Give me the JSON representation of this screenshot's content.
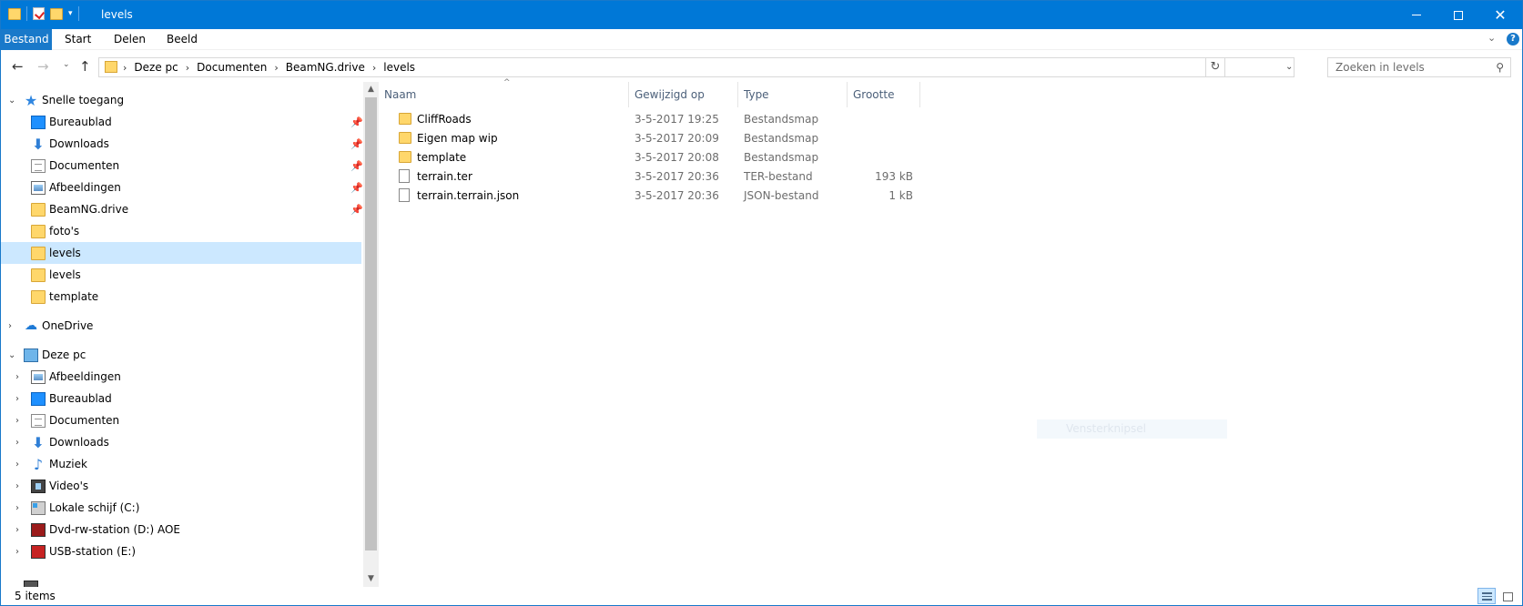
{
  "window": {
    "title": "levels",
    "controls": {
      "minimize": "minimize",
      "maximize": "maximize",
      "close": "close"
    }
  },
  "ribbon": {
    "tabs": [
      {
        "label": "Bestand",
        "active": true
      },
      {
        "label": "Start"
      },
      {
        "label": "Delen"
      },
      {
        "label": "Beeld"
      }
    ],
    "help_label": "?"
  },
  "navigation": {
    "breadcrumb": [
      "Deze pc",
      "Documenten",
      "BeamNG.drive",
      "levels"
    ],
    "search_placeholder": "Zoeken in levels"
  },
  "nav_pane": {
    "quick_access": {
      "label": "Snelle toegang",
      "icon": "star-icon",
      "items": [
        {
          "label": "Bureaublad",
          "icon": "desktop-icon",
          "pinned": true
        },
        {
          "label": "Downloads",
          "icon": "download-arrow-icon",
          "pinned": true
        },
        {
          "label": "Documenten",
          "icon": "document-icon",
          "pinned": true
        },
        {
          "label": "Afbeeldingen",
          "icon": "pictures-icon",
          "pinned": true
        },
        {
          "label": "BeamNG.drive",
          "icon": "folder-icon",
          "pinned": true
        },
        {
          "label": "foto's",
          "icon": "folder-icon"
        },
        {
          "label": "levels",
          "icon": "folder-icon",
          "selected": true
        },
        {
          "label": "levels",
          "icon": "folder-icon"
        },
        {
          "label": "template",
          "icon": "folder-icon"
        }
      ]
    },
    "onedrive": {
      "label": "OneDrive",
      "icon": "cloud-icon"
    },
    "this_pc": {
      "label": "Deze pc",
      "icon": "computer-icon",
      "items": [
        {
          "label": "Afbeeldingen",
          "icon": "pictures-icon"
        },
        {
          "label": "Bureaublad",
          "icon": "desktop-icon"
        },
        {
          "label": "Documenten",
          "icon": "document-icon"
        },
        {
          "label": "Downloads",
          "icon": "download-arrow-icon"
        },
        {
          "label": "Muziek",
          "icon": "music-note-icon"
        },
        {
          "label": "Video's",
          "icon": "video-icon"
        },
        {
          "label": "Lokale schijf (C:)",
          "icon": "drive-icon"
        },
        {
          "label": "Dvd-rw-station (D:) AOE",
          "icon": "dvd-icon"
        },
        {
          "label": "USB-station (E:)",
          "icon": "usb-drive-icon"
        }
      ]
    }
  },
  "file_list": {
    "columns": [
      "Naam",
      "Gewijzigd op",
      "Type",
      "Grootte"
    ],
    "rows": [
      {
        "name": "CliffRoads",
        "modified": "3-5-2017 19:25",
        "type": "Bestandsmap",
        "size": "",
        "icon": "folder-icon"
      },
      {
        "name": "Eigen map wip",
        "modified": "3-5-2017 20:09",
        "type": "Bestandsmap",
        "size": "",
        "icon": "folder-icon"
      },
      {
        "name": "template",
        "modified": "3-5-2017 20:08",
        "type": "Bestandsmap",
        "size": "",
        "icon": "folder-icon"
      },
      {
        "name": "terrain.ter",
        "modified": "3-5-2017 20:36",
        "type": "TER-bestand",
        "size": "193 kB",
        "icon": "file-icon"
      },
      {
        "name": "terrain.terrain.json",
        "modified": "3-5-2017 20:36",
        "type": "JSON-bestand",
        "size": "1 kB",
        "icon": "file-icon"
      }
    ]
  },
  "overlay": {
    "snip_label": "Vensterknipsel"
  },
  "status": {
    "item_count": "5 items"
  }
}
